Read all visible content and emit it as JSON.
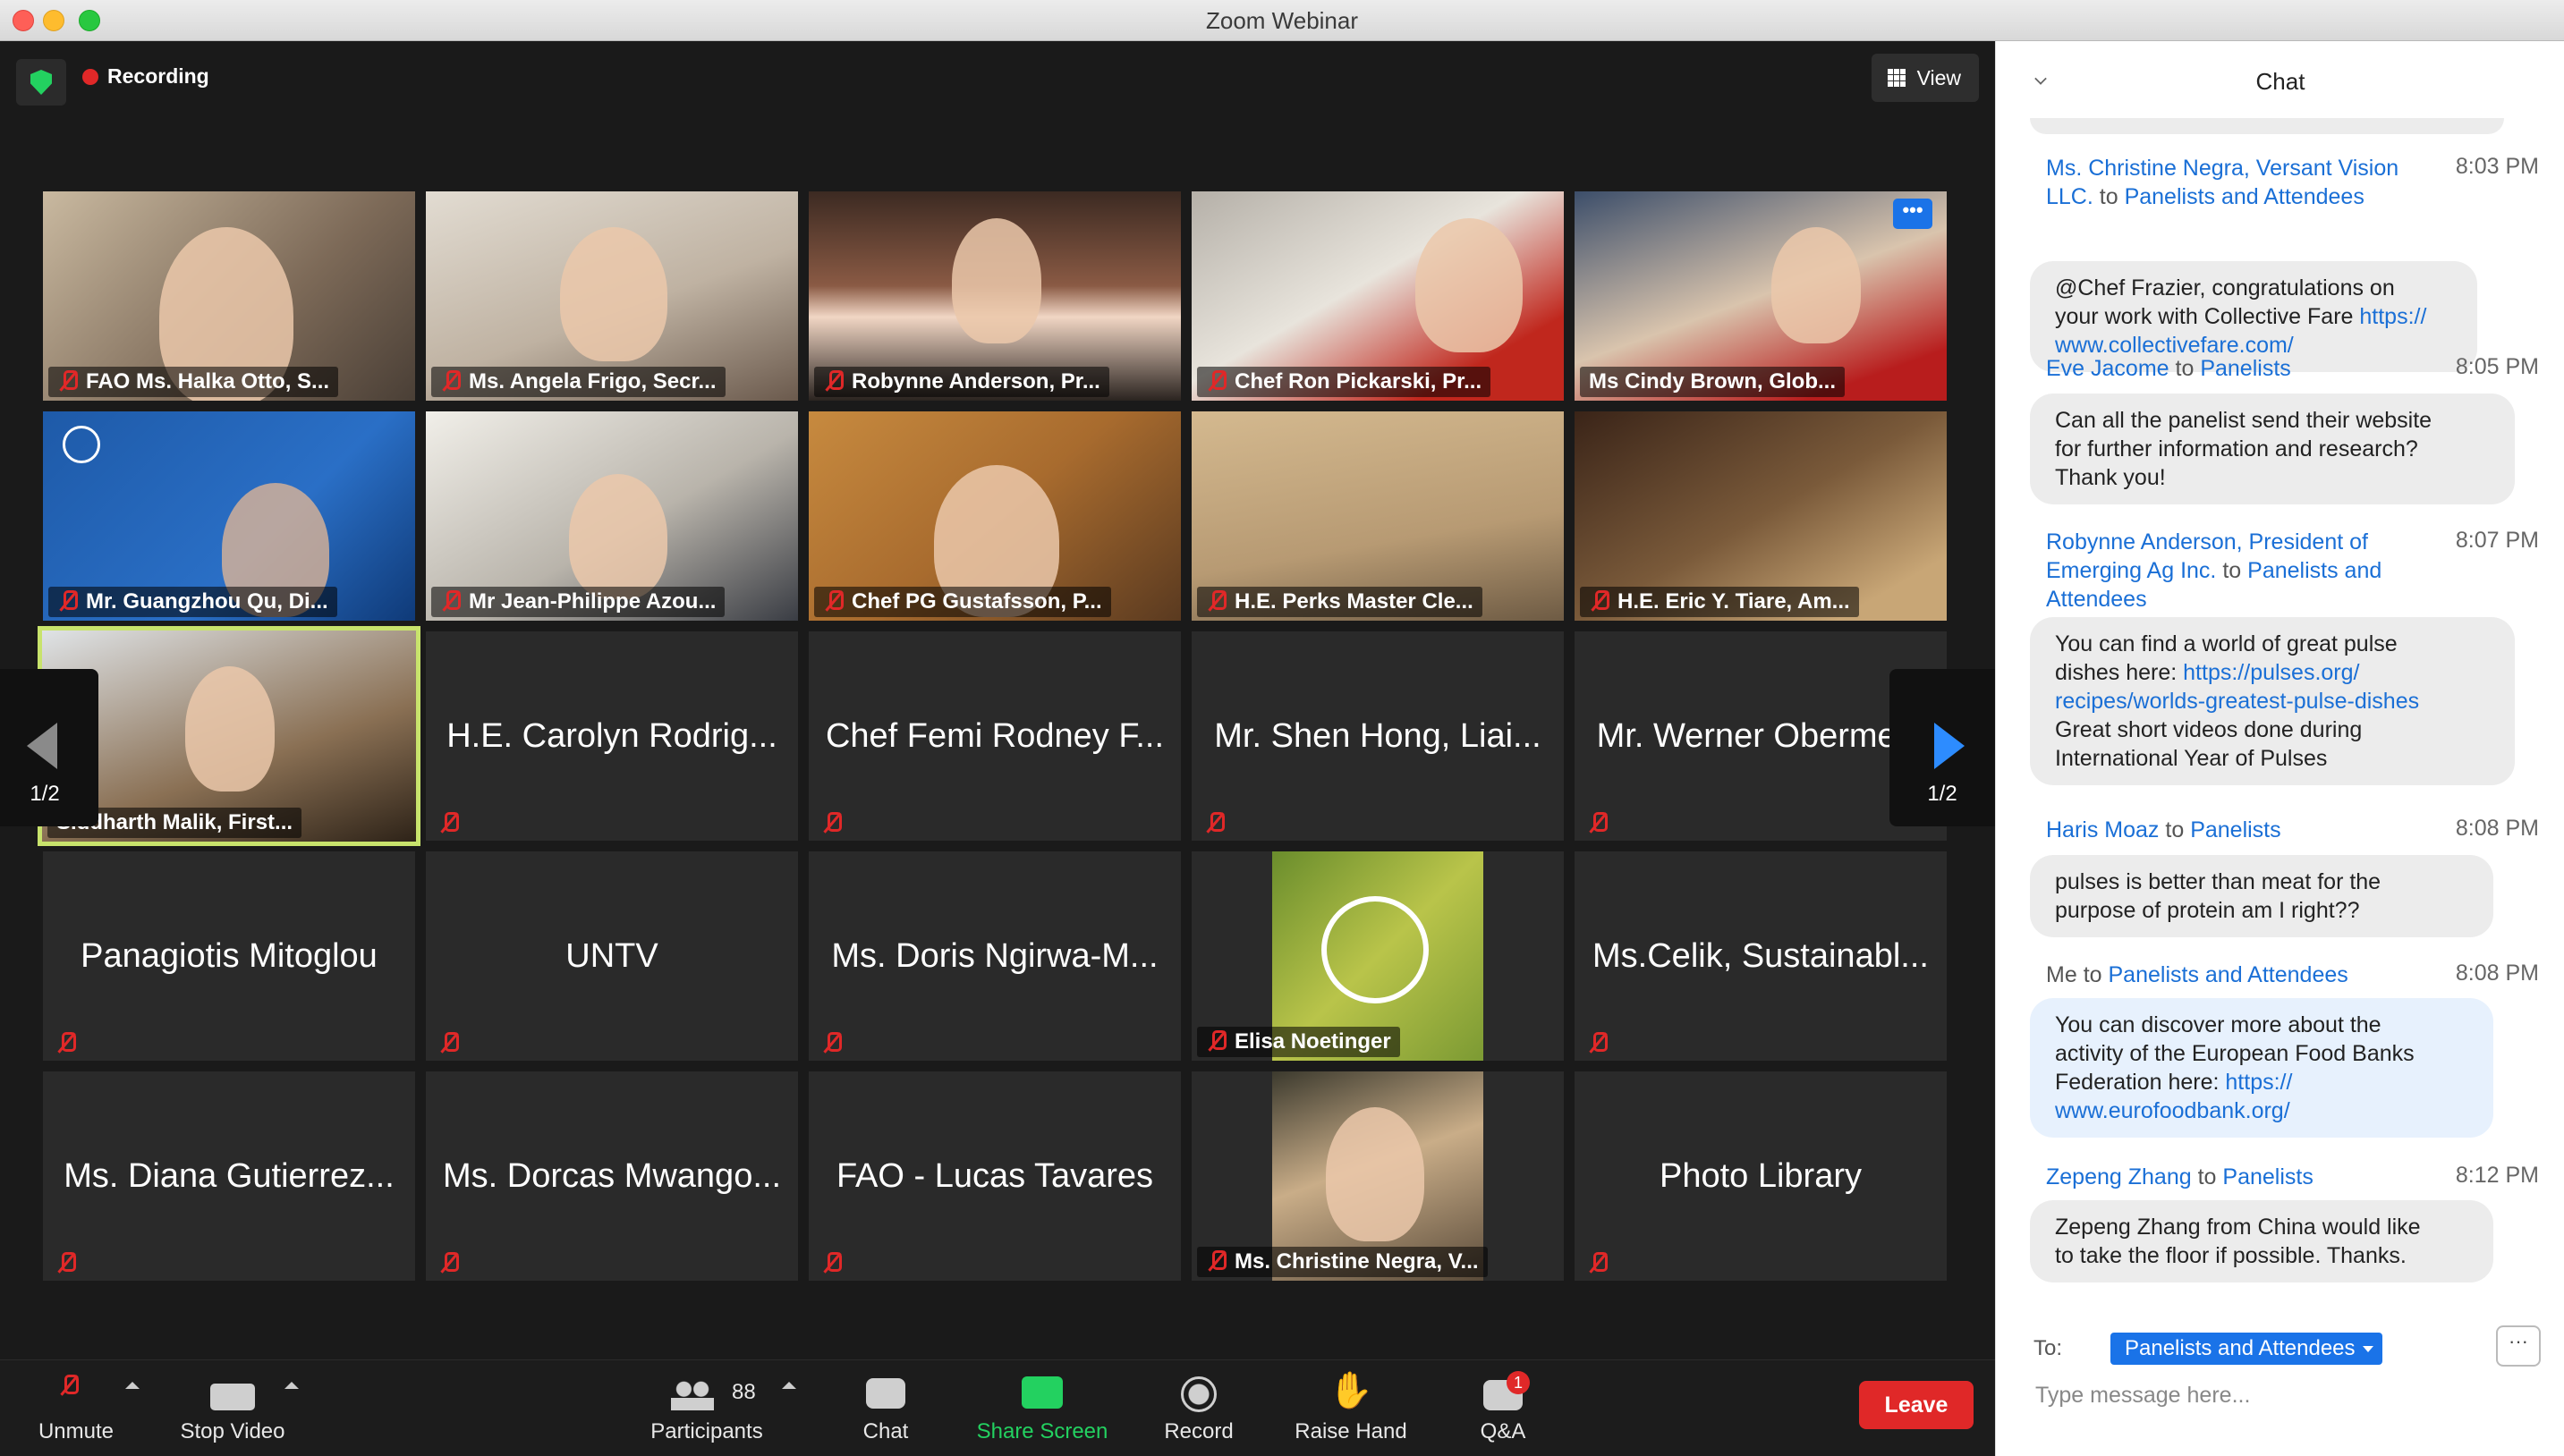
{
  "window": {
    "title": "Zoom Webinar"
  },
  "meeting": {
    "recording_label": "Recording",
    "view_label": "View",
    "page_indicator": "1/2"
  },
  "tiles": [
    {
      "name": "FAO Ms. Halka Otto, S...",
      "type": "video"
    },
    {
      "name": "Ms. Angela Frigo, Secr...",
      "type": "video"
    },
    {
      "name": "Robynne Anderson, Pr...",
      "type": "video"
    },
    {
      "name": "Chef Ron Pickarski, Pr...",
      "type": "video"
    },
    {
      "name": "Ms Cindy Brown, Glob...",
      "type": "video"
    },
    {
      "name": "Mr. Guangzhou Qu, Di...",
      "type": "video"
    },
    {
      "name": "Mr Jean-Philippe Azou...",
      "type": "video"
    },
    {
      "name": "Chef PG Gustafsson, P...",
      "type": "video"
    },
    {
      "name": "H.E. Perks Master Cle...",
      "type": "video"
    },
    {
      "name": "H.E. Eric Y. Tiare, Am...",
      "type": "video"
    },
    {
      "name": "Siddharth Malik, First...",
      "type": "video"
    },
    {
      "name": "H.E. Carolyn Rodrig...",
      "type": "name"
    },
    {
      "name": "Chef Femi Rodney F...",
      "type": "name"
    },
    {
      "name": "Mr. Shen Hong, Liai...",
      "type": "name"
    },
    {
      "name": "Mr. Werner Oberme...",
      "type": "name"
    },
    {
      "name": "Panagiotis Mitoglou",
      "type": "name"
    },
    {
      "name": "UNTV",
      "type": "name"
    },
    {
      "name": "Ms. Doris Ngirwa-M...",
      "type": "name"
    },
    {
      "name": "Elisa Noetinger",
      "type": "video"
    },
    {
      "name": "Ms.Celik, Sustainabl...",
      "type": "name"
    },
    {
      "name": "Ms. Diana Gutierrez...",
      "type": "name"
    },
    {
      "name": "Ms. Dorcas Mwango...",
      "type": "name"
    },
    {
      "name": "FAO - Lucas Tavares",
      "type": "name"
    },
    {
      "name": "Ms. Christine Negra, V...",
      "type": "video"
    },
    {
      "name": "Photo Library",
      "type": "name"
    }
  ],
  "toolbar": {
    "unmute": "Unmute",
    "stop_video": "Stop Video",
    "participants": "Participants",
    "participants_count": "88",
    "chat": "Chat",
    "share_screen": "Share Screen",
    "record": "Record",
    "raise_hand": "Raise Hand",
    "qa": "Q&A",
    "qa_badge": "1",
    "leave": "Leave"
  },
  "chat": {
    "title": "Chat",
    "messages": [
      {
        "sender": "Ms. Christine Negra, Versant Vision",
        "sender2": "LLC.",
        "to_word": "to",
        "recipient": "Panelists and Attendees",
        "time": "8:03 PM",
        "text": "@Chef Frazier, congratulations on",
        "text2": "your work with Collective Fare",
        "link1": "https://",
        "link2": "www.collectivefare.com/"
      },
      {
        "sender": "Eve Jacome",
        "to_word": "to",
        "recipient": "Panelists",
        "time": "8:05 PM",
        "text": "Can all the panelist send their website",
        "text2": "for further information and research?",
        "text3": "Thank you!"
      },
      {
        "sender": "Robynne Anderson, President of",
        "sender2": "Emerging Ag Inc.",
        "to_word": "to",
        "recipient": "Panelists and",
        "recipient2": "Attendees",
        "time": "8:07 PM",
        "text": "You can find a world of great pulse",
        "text2": "dishes here:",
        "link1": "https://pulses.org/",
        "link2": "recipes/worlds-greatest-pulse-dishes",
        "text3": "Great short videos done during",
        "text4": "International Year of Pulses"
      },
      {
        "sender": "Haris Moaz",
        "to_word": "to",
        "recipient": "Panelists",
        "time": "8:08 PM",
        "text": "pulses is better than meat for the",
        "text2": "purpose of protein am I right??"
      },
      {
        "sender": "Me",
        "to_word": "to",
        "recipient": "Panelists and Attendees",
        "time": "8:08 PM",
        "text": "You can discover more about the",
        "text2": "activity of the European Food Banks",
        "text3": "Federation here:",
        "link1": "https://",
        "link2": "www.eurofoodbank.org/"
      },
      {
        "sender": "Zepeng Zhang",
        "to_word": "to",
        "recipient": "Panelists",
        "time": "8:12 PM",
        "text": "Zepeng Zhang from China would like",
        "text2": "to take the floor if possible. Thanks."
      }
    ],
    "to_label": "To:",
    "to_value": "Panelists and Attendees",
    "input_placeholder": "Type message here...",
    "more_label": "···"
  },
  "colors": {
    "accent": "#1a73e8",
    "leave": "#e02828",
    "share": "#23d160",
    "muted": "#e02828"
  }
}
